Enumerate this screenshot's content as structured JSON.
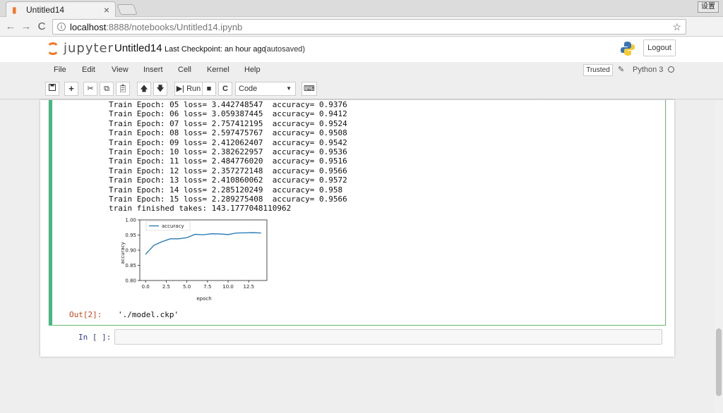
{
  "browser": {
    "tab_title": "Untitled14",
    "tab_close": "×",
    "window_button": "设置",
    "url_host": "localhost",
    "url_path": ":8888/notebooks/Untitled14.ipynb",
    "back": "←",
    "forward": "→",
    "reload": "C",
    "star": "☆",
    "menu": "⋮"
  },
  "header": {
    "logo_text": "jupyter",
    "notebook_name": "Untitled14",
    "checkpoint": "Last Checkpoint: an hour ago",
    "autosave": "(autosaved)",
    "logout": "Logout"
  },
  "menubar": {
    "items": [
      "File",
      "Edit",
      "View",
      "Insert",
      "Cell",
      "Kernel",
      "Help"
    ],
    "trusted": "Trusted",
    "kernel_name": "Python 3"
  },
  "toolbar": {
    "run_label": "Run",
    "cell_type": "Code",
    "icons": [
      "save-icon",
      "plus-icon",
      "cut-icon",
      "copy-icon",
      "paste-icon",
      "arrow-up-icon",
      "arrow-down-icon",
      "run-icon",
      "stop-icon",
      "restart-icon",
      "keyboard-icon"
    ]
  },
  "cell_output": {
    "lines": [
      "Train Epoch: 05 loss= 3.442748547  accuracy= 0.9376",
      "Train Epoch: 06 loss= 3.059387445  accuracy= 0.9412",
      "Train Epoch: 07 loss= 2.757412195  accuracy= 0.9524",
      "Train Epoch: 08 loss= 2.597475767  accuracy= 0.9508",
      "Train Epoch: 09 loss= 2.412062407  accuracy= 0.9542",
      "Train Epoch: 10 loss= 2.382622957  accuracy= 0.9536",
      "Train Epoch: 11 loss= 2.484776020  accuracy= 0.9516",
      "Train Epoch: 12 loss= 2.357272148  accuracy= 0.9566",
      "Train Epoch: 13 loss= 2.410860062  accuracy= 0.9572",
      "Train Epoch: 14 loss= 2.285120249  accuracy= 0.958",
      "Train Epoch: 15 loss= 2.289275408  accuracy= 0.9566",
      "train finished takes: 143.1777048110962"
    ],
    "out_prompt": "Out[2]:",
    "out_value": "'./model.ckp'"
  },
  "next_cell": {
    "in_prompt": "In [ ]:"
  },
  "chart_data": {
    "type": "line",
    "xlabel": "epoch",
    "ylabel": "accuracy",
    "xlim": [
      -0.7,
      14.7
    ],
    "ylim": [
      0.8,
      1.0
    ],
    "xticks": [
      "0.0",
      "2.5",
      "5.0",
      "7.5",
      "10.0",
      "12.5"
    ],
    "xtick_values": [
      0,
      2.5,
      5,
      7.5,
      10,
      12.5
    ],
    "yticks": [
      "0.80",
      "0.85",
      "0.90",
      "0.95",
      "1.00"
    ],
    "ytick_values": [
      0.8,
      0.85,
      0.9,
      0.95,
      1.0
    ],
    "legend_position": "upper-left",
    "series": [
      {
        "name": "accuracy",
        "color": "#1f77b4",
        "x": [
          0,
          1,
          2,
          3,
          4,
          5,
          6,
          7,
          8,
          9,
          10,
          11,
          12,
          13,
          14
        ],
        "values": [
          0.8864,
          0.9158,
          0.9282,
          0.9376,
          0.9376,
          0.9412,
          0.9524,
          0.9508,
          0.9542,
          0.9536,
          0.9516,
          0.9566,
          0.9572,
          0.958,
          0.9566
        ]
      }
    ]
  }
}
